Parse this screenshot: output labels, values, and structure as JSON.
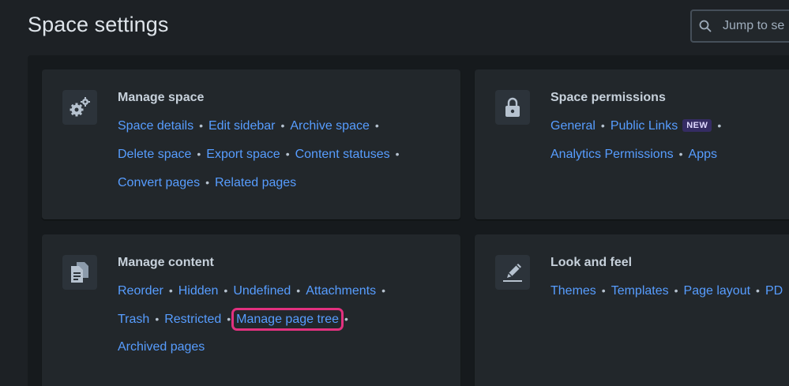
{
  "page": {
    "title": "Space settings"
  },
  "search": {
    "placeholder": "Jump to se"
  },
  "cards": {
    "manage_space": {
      "title": "Manage space",
      "icon": "gears-icon",
      "links": [
        "Space details",
        "Edit sidebar",
        "Archive space",
        "Delete space",
        "Export space",
        "Content statuses",
        "Convert pages",
        "Related pages"
      ]
    },
    "space_permissions": {
      "title": "Space permissions",
      "icon": "lock-icon",
      "links": [
        "General",
        "Public Links",
        "Analytics Permissions",
        "Apps"
      ],
      "badge": "NEW"
    },
    "manage_content": {
      "title": "Manage content",
      "icon": "documents-icon",
      "links": [
        "Reorder",
        "Hidden",
        "Undefined",
        "Attachments",
        "Trash",
        "Restricted",
        "Manage page tree",
        "Archived pages"
      ]
    },
    "look_and_feel": {
      "title": "Look and feel",
      "icon": "pen-icon",
      "links": [
        "Themes",
        "Templates",
        "Page layout",
        "PD"
      ]
    }
  },
  "colors": {
    "background": "#1d2125",
    "card": "#22272b",
    "link": "#579dff",
    "highlight": "#e2317f",
    "badge_bg": "#352c63"
  }
}
